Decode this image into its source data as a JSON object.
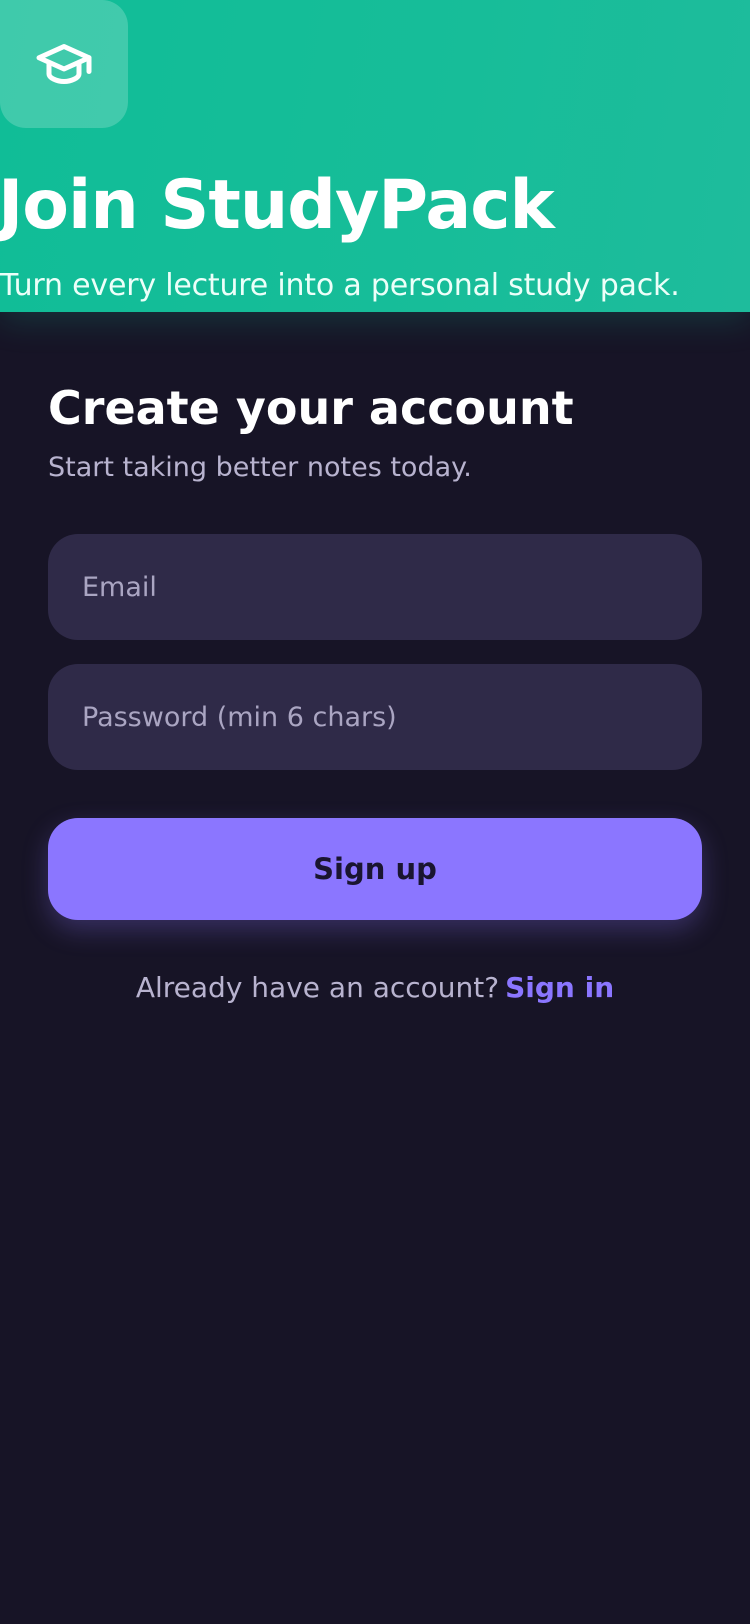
{
  "hero": {
    "logo_icon": "graduation-cap-icon",
    "title": "Join StudyPack",
    "subtitle": "Turn every lecture into a personal study pack."
  },
  "form": {
    "title": "Create your account",
    "subtitle": "Start taking better notes today.",
    "email_placeholder": "Email",
    "password_placeholder": "Password (min 6 chars)",
    "submit_label": "Sign up",
    "footer_prompt": "Already have an account?",
    "signin_label": "Sign in"
  },
  "colors": {
    "hero_bg": "#14bc98",
    "page_bg": "#171426",
    "input_bg": "#2f2a48",
    "accent": "#8b76ff"
  }
}
